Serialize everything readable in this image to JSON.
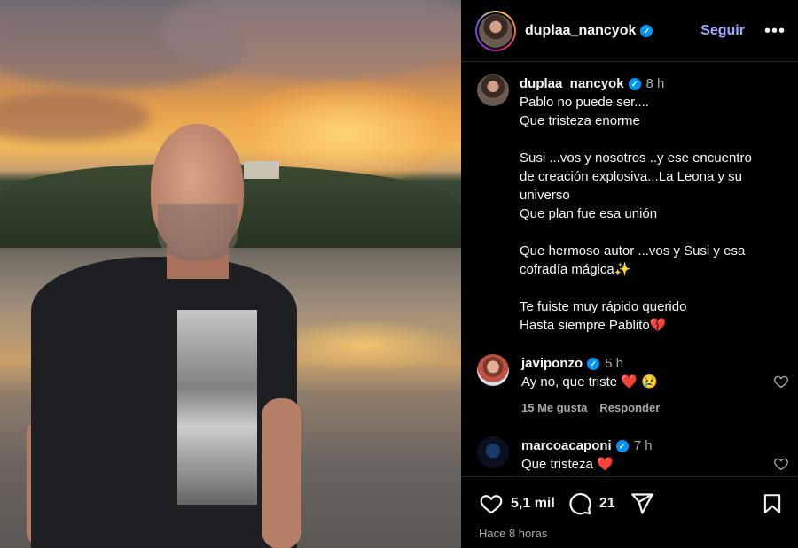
{
  "post": {
    "username": "duplaa_nancyok",
    "follow_label": "Seguir",
    "more_label": "•••"
  },
  "caption": {
    "username": "duplaa_nancyok",
    "time": "8 h",
    "lines": [
      "Pablo no puede ser....",
      "Que tristeza enorme",
      "",
      "Susi ...vos y nosotros ..y ese encuentro",
      "de creación explosiva...La Leona y su",
      "universo",
      "Que  plan fue esa unión",
      "",
      "Que hermoso autor ...vos y Susi y esa",
      "cofradía mágica✨",
      "",
      "Te fuiste muy rápido querido",
      "Hasta siempre Pablito💔"
    ]
  },
  "comments": [
    {
      "username": "javiponzo",
      "time": "5 h",
      "text": "Ay no, que triste ❤️ 😢",
      "likes": "15 Me gusta",
      "reply_label": "Responder"
    },
    {
      "username": "marcoacaponi",
      "time": "7 h",
      "text": "Que tristeza ❤️"
    }
  ],
  "footer": {
    "likes": "5,1 mil",
    "comments": "21",
    "posted_ago": "Hace 8 horas"
  },
  "colors": {
    "follow": "#a0a8ff",
    "verified": "#0095f6",
    "background": "#000000"
  }
}
